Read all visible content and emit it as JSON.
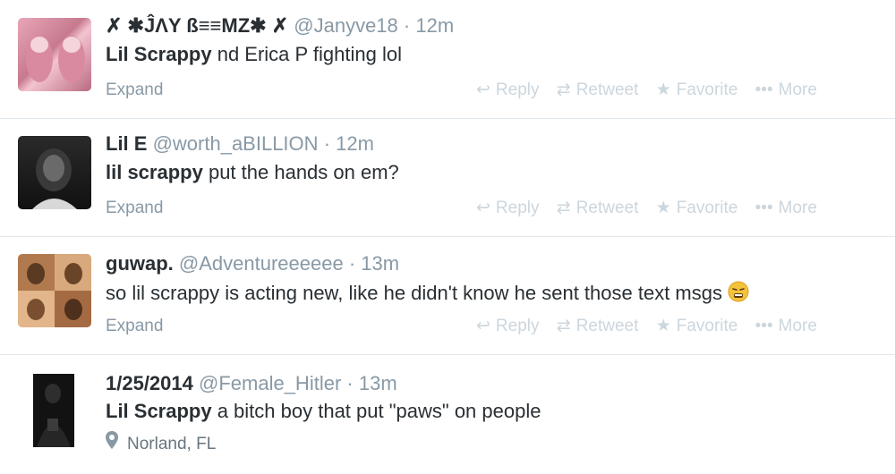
{
  "tweets": [
    {
      "name": "✗ ✱ĴΛY ß≡≡MZ✱ ✗",
      "handle": "@Janyve18",
      "separator": "·",
      "time": "12m",
      "text_bold": "Lil Scrappy",
      "text_rest": " nd Erica P fighting lol",
      "expand": "Expand",
      "avatar_icon": "profile-photo"
    },
    {
      "name": "Lil E",
      "handle": "@worth_aBILLION",
      "separator": "·",
      "time": "12m",
      "text_bold": "lil scrappy",
      "text_rest": " put the hands on em?",
      "expand": "Expand",
      "avatar_icon": "profile-photo"
    },
    {
      "name": "guwap.",
      "handle": "@Adventureeeeee",
      "separator": "·",
      "time": "13m",
      "text_bold": "",
      "text_rest": "so lil scrappy is acting new, like he didn't know he sent those text msgs",
      "expand": "Expand",
      "avatar_icon": "profile-photo"
    },
    {
      "name": "1/25/2014",
      "handle": "@Female_Hitler",
      "separator": "·",
      "time": "13m",
      "text_bold": "Lil Scrappy",
      "text_rest": " a bitch boy that put \"paws\" on people",
      "location": "Norland, FL",
      "avatar_icon": "profile-photo"
    }
  ],
  "actions": {
    "reply": "Reply",
    "retweet": "Retweet",
    "favorite": "Favorite",
    "more": "More"
  },
  "icons": {
    "reply": "reply-arrow-icon",
    "retweet": "retweet-icon",
    "favorite": "star-icon",
    "more": "more-dots-icon",
    "location": "location-pin-icon",
    "emoji": "tired-face-emoji"
  },
  "colors": {
    "text": "#292f33",
    "meta": "#8899a6",
    "action": "#ccd6dd",
    "divider": "#e1e8ed"
  }
}
